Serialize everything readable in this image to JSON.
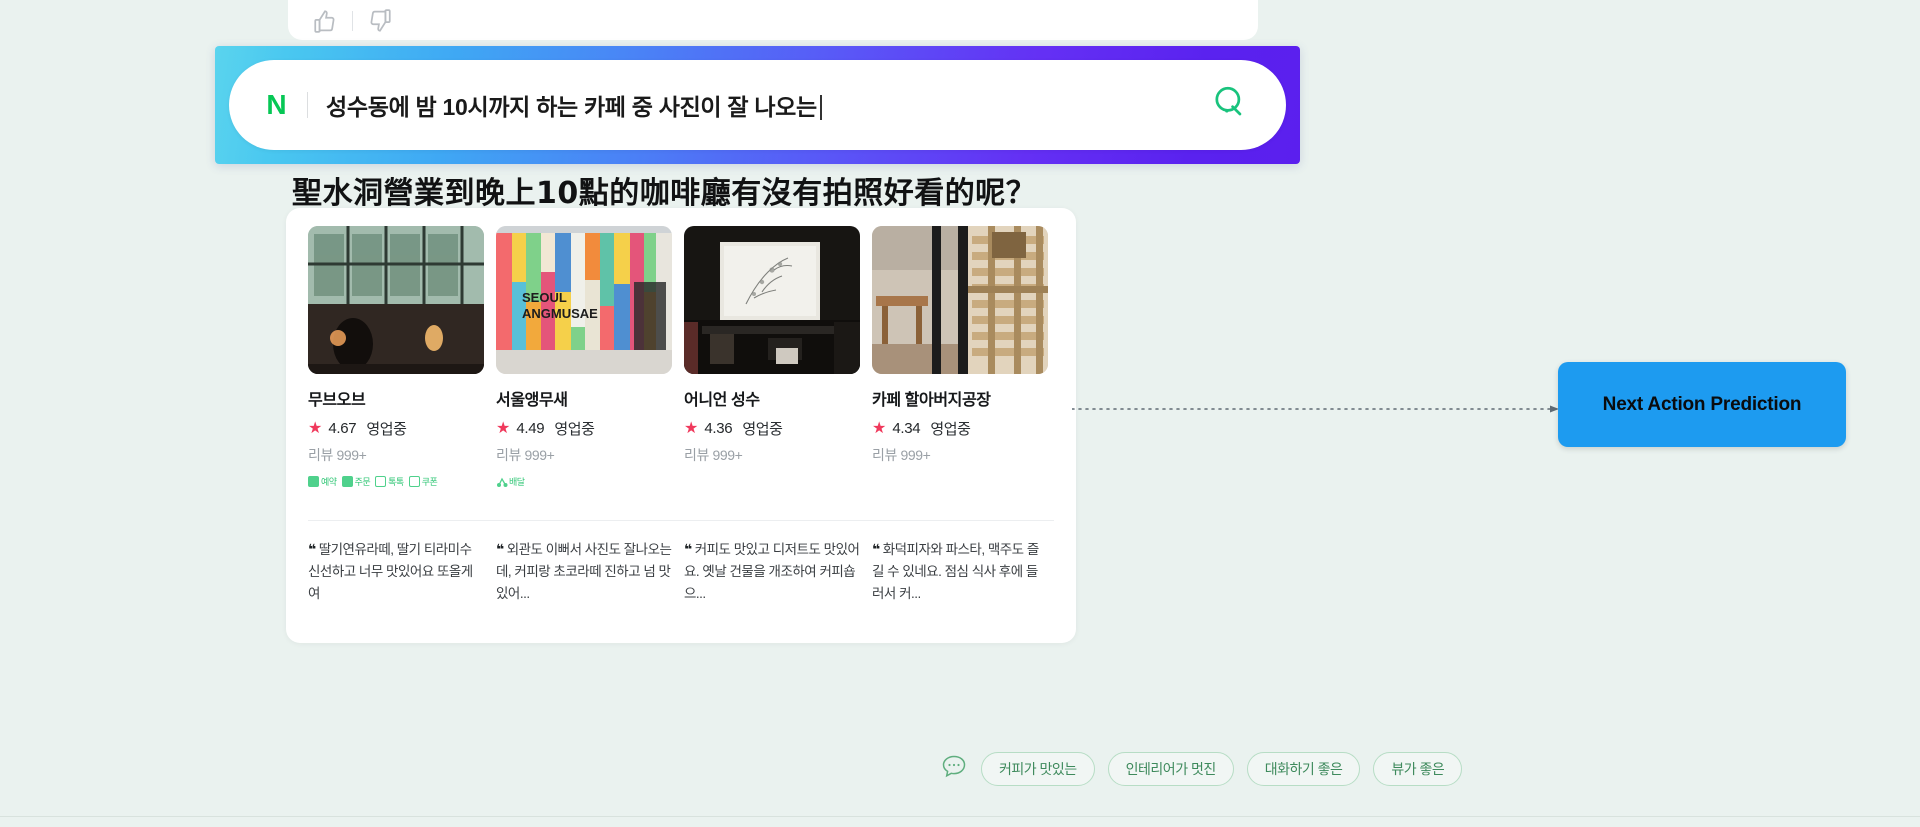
{
  "top_actions": {
    "thumbs_up_icon": "thumbs-up-icon",
    "thumbs_down_icon": "thumbs-down-icon"
  },
  "search": {
    "brand_letter": "N",
    "query": "성수동에 밤 10시까지 하는 카페 중 사진이 잘 나오는",
    "search_icon": "search-icon",
    "gradient_from": "#5ad4ee",
    "gradient_to": "#5b1fee"
  },
  "translated_title": "聖水洞營業到晚上10點的咖啡廳有沒有拍照好看的呢？",
  "results": {
    "cards": [
      {
        "name": "무브오브",
        "rating": "4.67",
        "status": "영업중",
        "reviews": "리뷰 999+",
        "badges": [
          "예약",
          "주문",
          "톡톡",
          "쿠폰"
        ],
        "quote": "딸기연유라떼, 딸기 티라미수 신선하고 너무 맛있어요 또올게여"
      },
      {
        "name": "서울앵무새",
        "rating": "4.49",
        "status": "영업중",
        "reviews": "리뷰 999+",
        "badges": [
          "배달"
        ],
        "quote": "외관도 이뻐서 사진도 잘나오는데, 커피랑 초코라떼 진하고 넘 맛있어..."
      },
      {
        "name": "어니언 성수",
        "rating": "4.36",
        "status": "영업중",
        "reviews": "리뷰 999+",
        "badges": [],
        "quote": "커피도 맛있고 디저트도 맛있어요. 옛날 건물을 개조하여 커피숍으..."
      },
      {
        "name": "카페 할아버지공장",
        "rating": "4.34",
        "status": "영업중",
        "reviews": "리뷰 999+",
        "badges": [],
        "quote": "화덕피자와 파스타, 맥주도 즐길 수 있네요. 점심 식사 후에 들러서 커..."
      }
    ],
    "star_glyph": "★",
    "quote_glyph": "❝"
  },
  "annotation": {
    "next_action_label": "Next Action Prediction",
    "box_color": "#1d9bf0",
    "connector": "dotted-arrow"
  },
  "suggestions": {
    "chat_icon": "chat-bubble-icon",
    "chips": [
      "커피가 맛있는",
      "인테리어가 멋진",
      "대화하기 좋은",
      "뷰가 좋은"
    ]
  }
}
